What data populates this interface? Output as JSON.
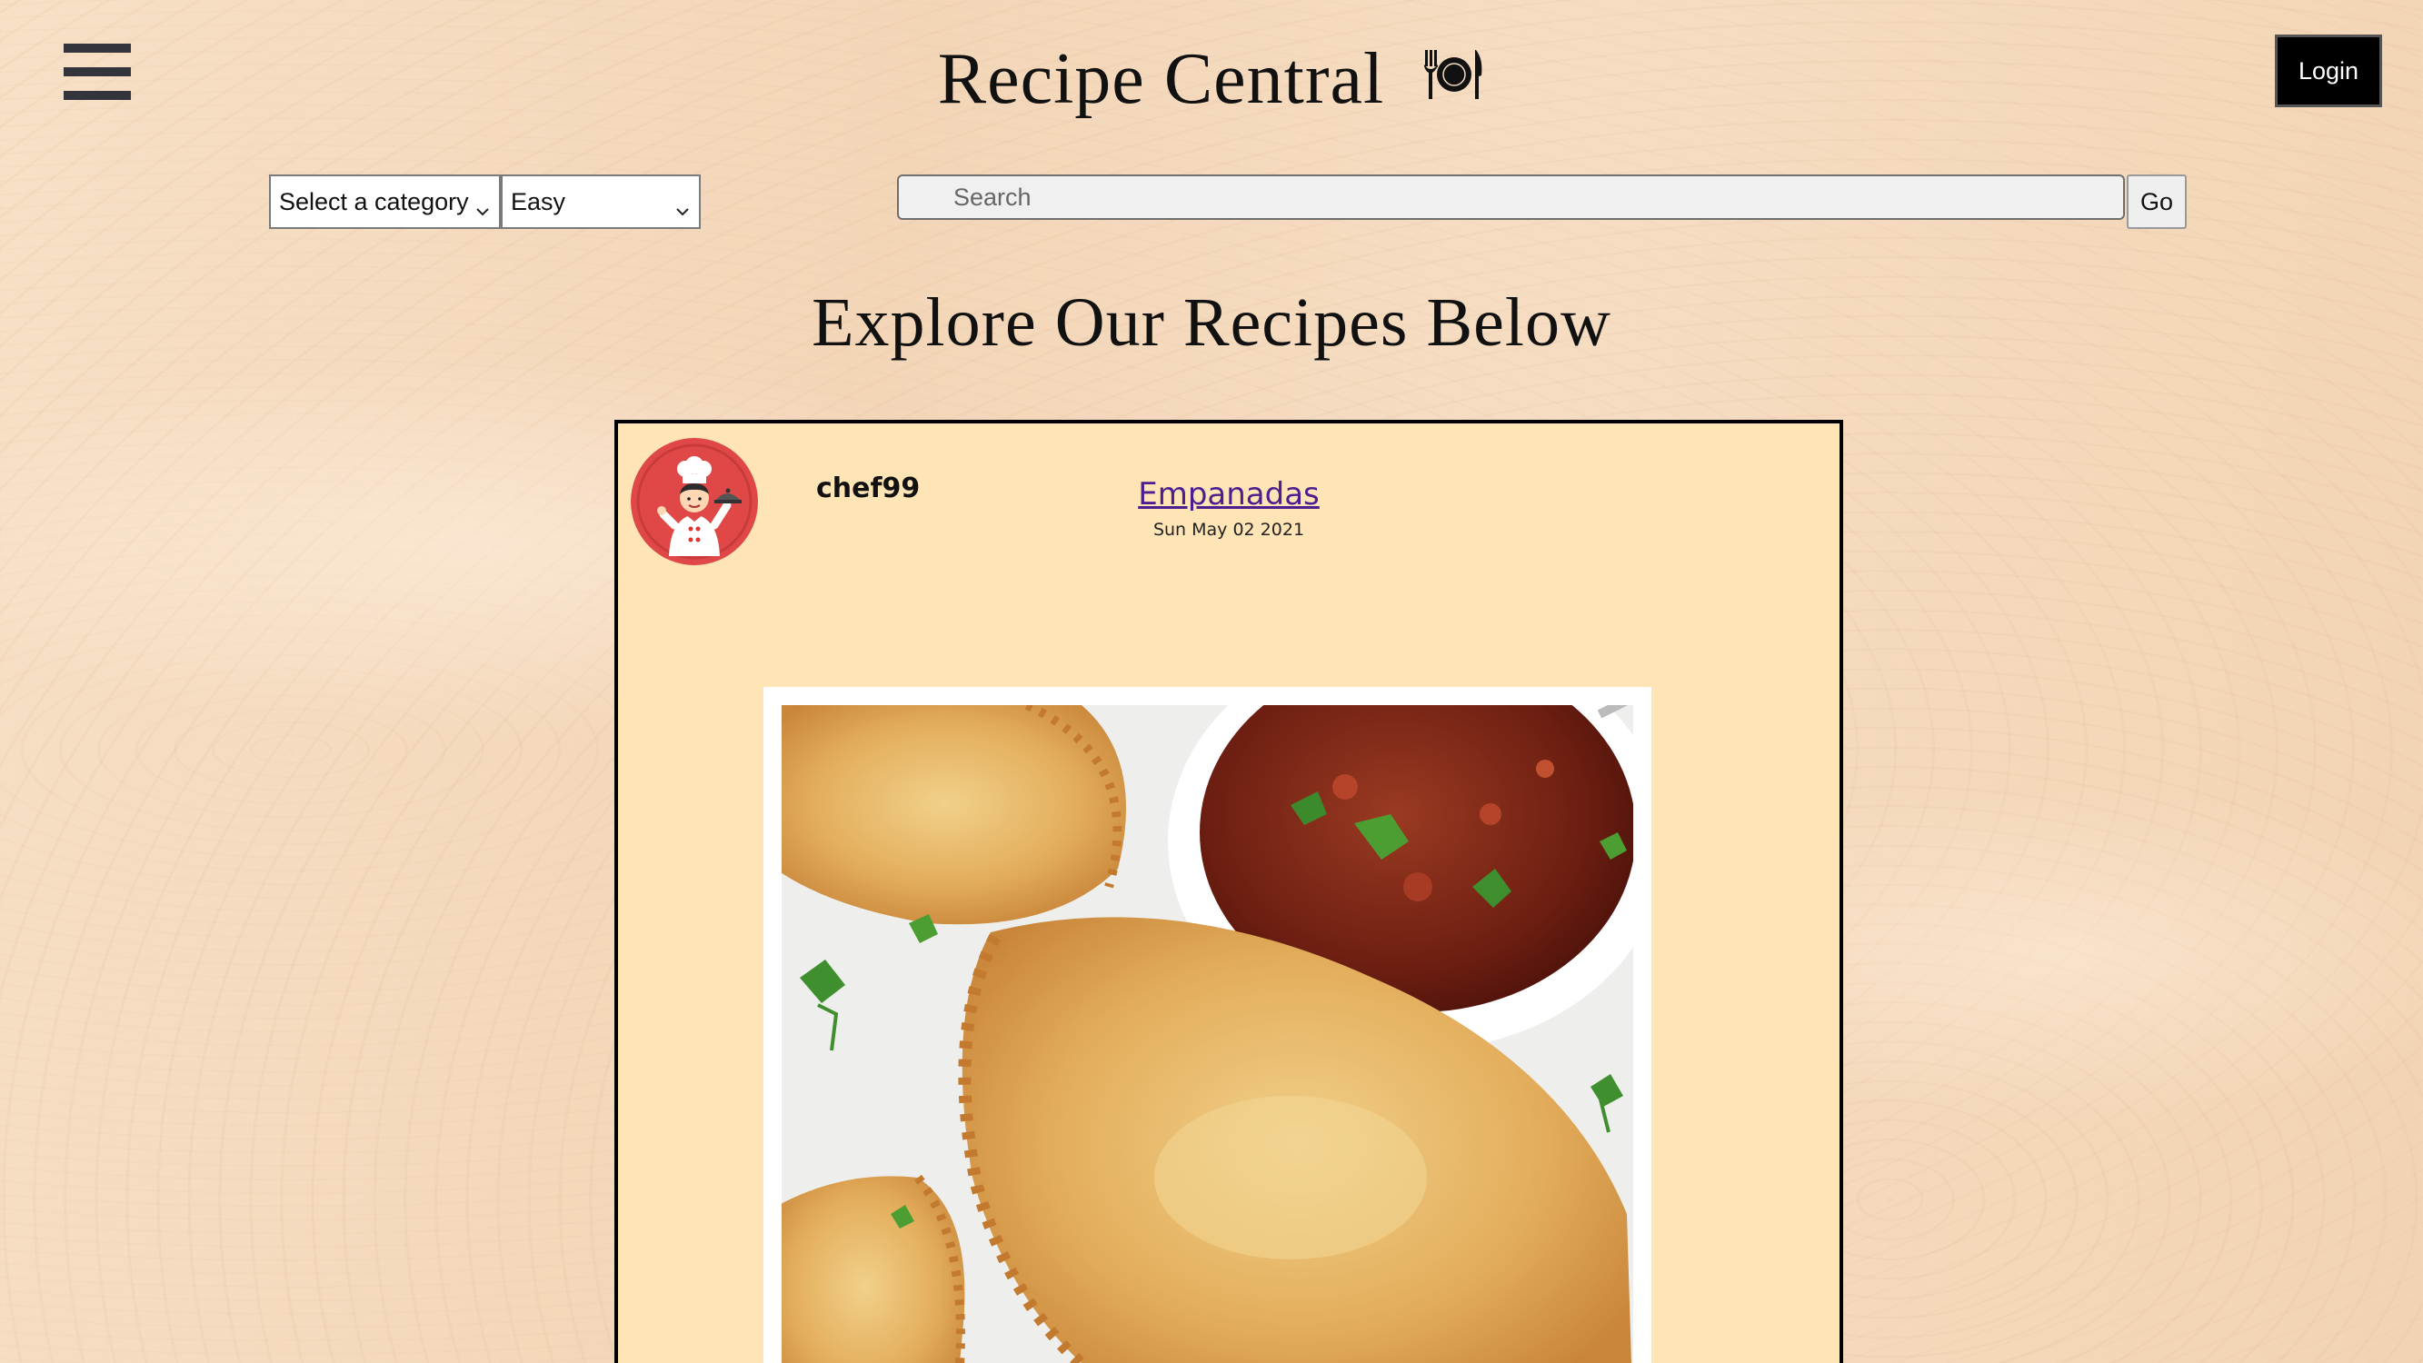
{
  "header": {
    "title": "Recipe Central",
    "login_label": "Login",
    "icons": {
      "menu": "hamburger-menu-icon",
      "title_icon": "plate-utensils-icon"
    }
  },
  "filters": {
    "category_selected": "Select a category",
    "difficulty_selected": "Easy",
    "search_placeholder": "Search",
    "go_label": "Go"
  },
  "main": {
    "heading": "Explore Our Recipes Below"
  },
  "recipes": [
    {
      "author": "chef99",
      "title": "Empanadas",
      "date": "Sun May 02 2021",
      "avatar_icon": "chef-avatar-icon",
      "image": "empanadas-with-salsa-photo"
    }
  ],
  "colors": {
    "card_background": "#ffe4b6",
    "link": "#4b1f8f",
    "avatar_circle": "#e04848",
    "login_background": "#000000"
  }
}
